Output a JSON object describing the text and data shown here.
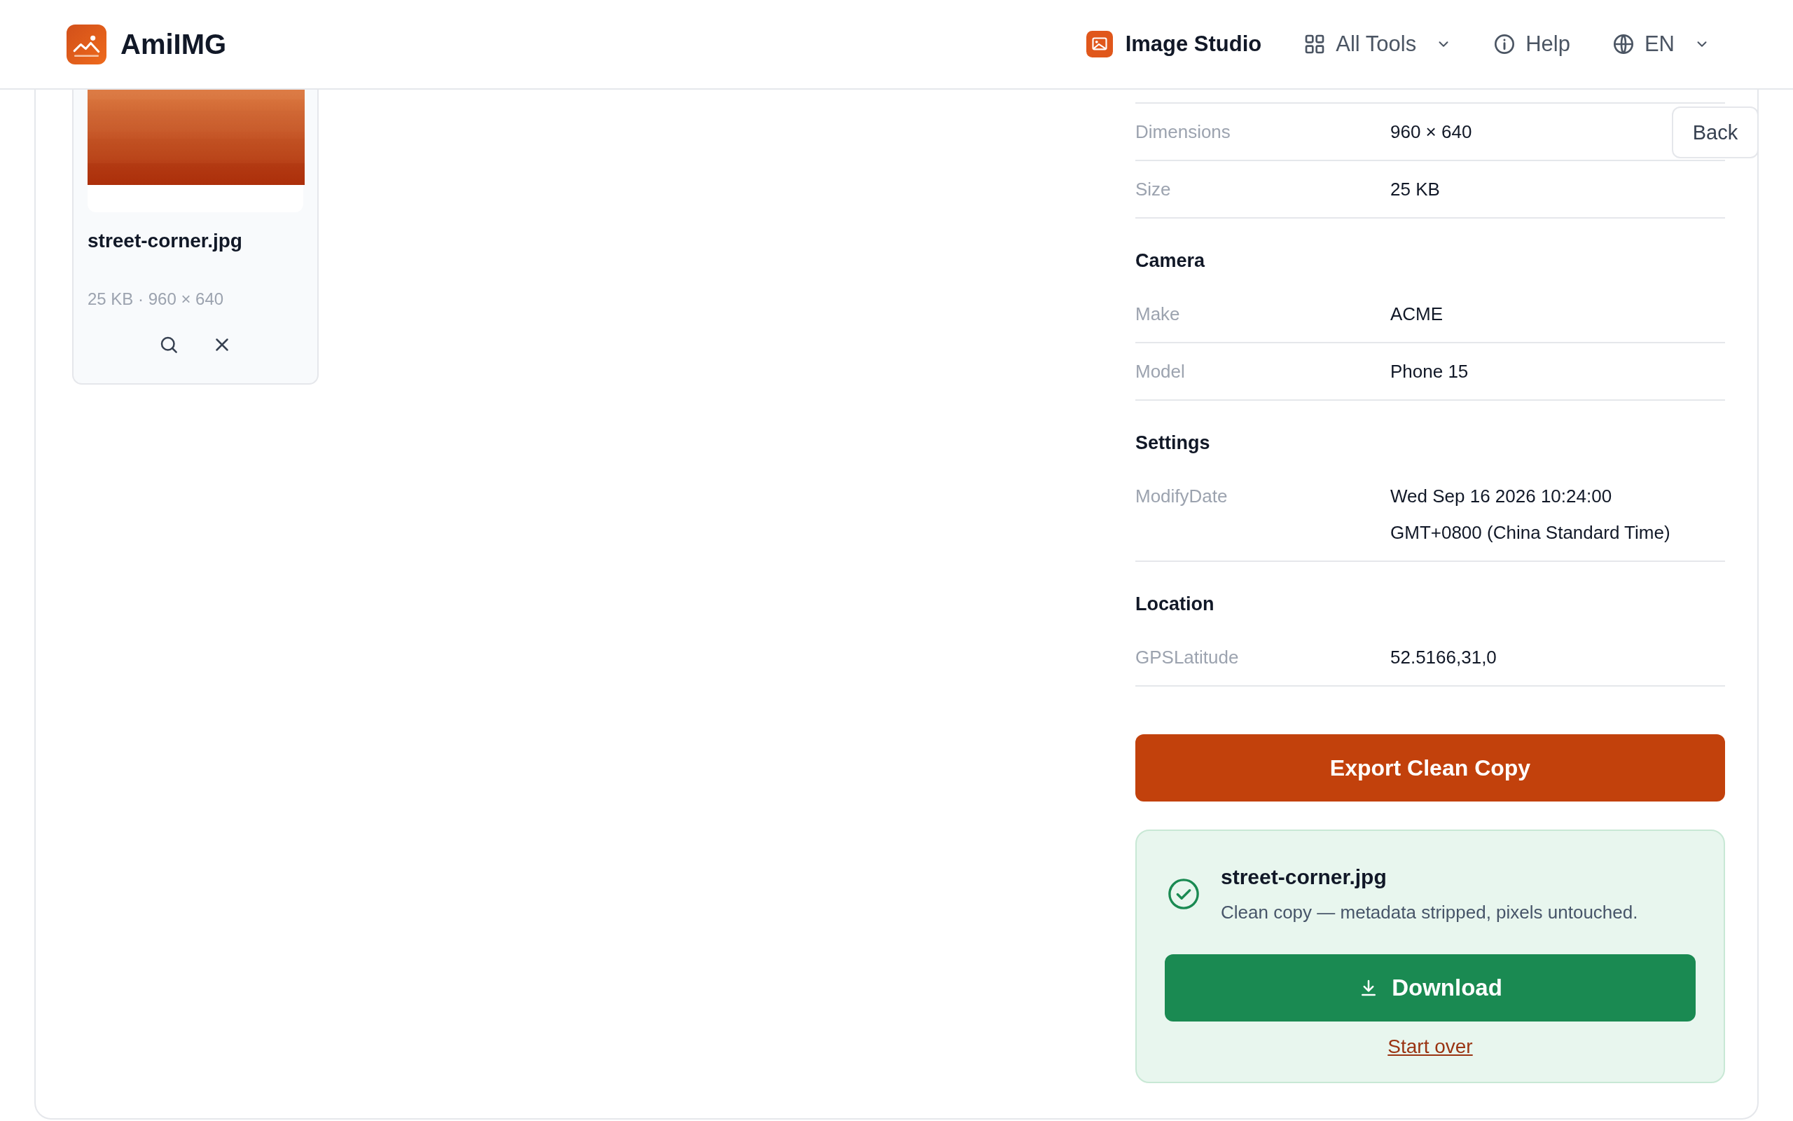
{
  "header": {
    "brand": "AmiIMG",
    "nav": [
      {
        "kind": "studio",
        "label": "Image Studio"
      },
      {
        "kind": "tools",
        "label": "All Tools"
      },
      {
        "kind": "help",
        "label": "Help"
      },
      {
        "kind": "language",
        "label": "EN"
      }
    ]
  },
  "files": [
    {
      "name": "street-corner.jpg",
      "meta": "25 KB · 960 × 640"
    }
  ],
  "back_button": "Back",
  "metadata": {
    "sections": [
      {
        "rows": [
          {
            "label": "Dimensions",
            "value": "960 × 640"
          },
          {
            "label": "Size",
            "value": "25 KB"
          }
        ]
      },
      {
        "title": "Camera",
        "rows": [
          {
            "label": "Make",
            "value": "ACME"
          },
          {
            "label": "Model",
            "value": "Phone 15"
          }
        ]
      },
      {
        "title": "Settings",
        "rows": [
          {
            "label": "ModifyDate",
            "value": "Wed Sep 16 2026 10:24:00 GMT+0800 (China Standard Time)"
          }
        ]
      },
      {
        "title": "Location",
        "rows": [
          {
            "label": "GPSLatitude",
            "value": "52.5166,31,0"
          }
        ]
      }
    ]
  },
  "export_button": "Export Clean Copy",
  "result": {
    "filename": "street-corner.jpg",
    "message": "Clean copy — metadata stripped, pixels untouched.",
    "download_button": "Download",
    "start_over_link": "Start over"
  }
}
